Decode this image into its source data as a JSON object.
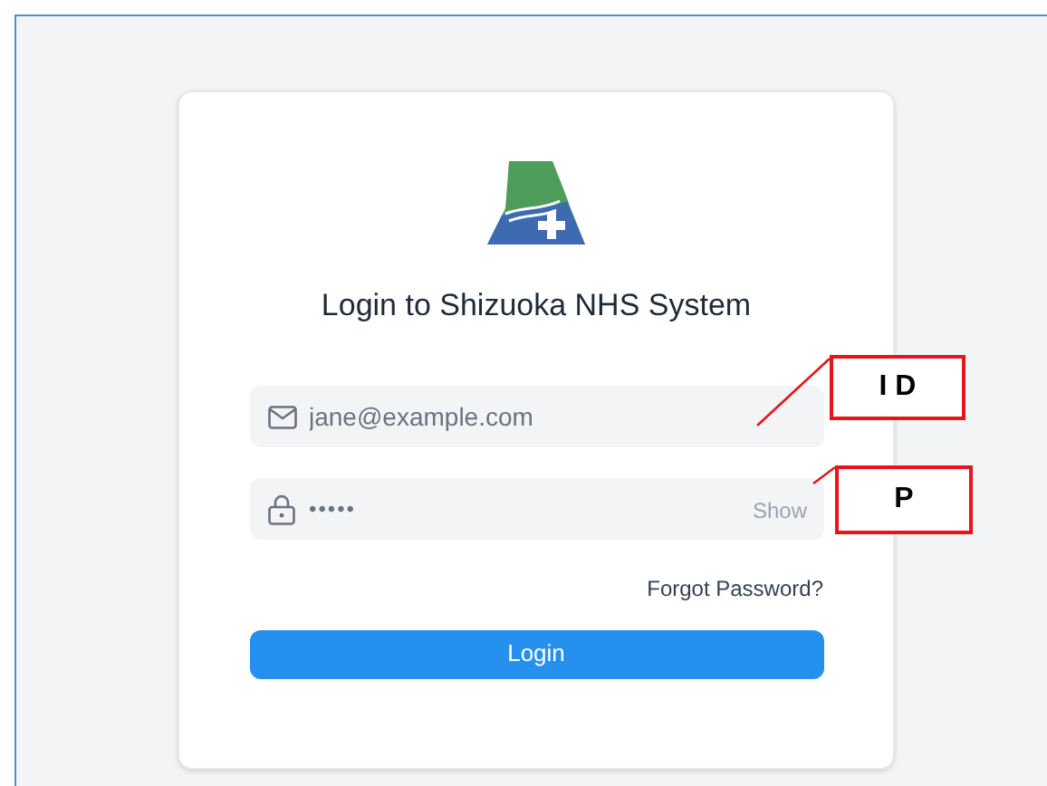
{
  "title": "Login to Shizuoka NHS System",
  "email_field": {
    "placeholder": "jane@example.com"
  },
  "password_field": {
    "value": "•••••",
    "toggle": "Show"
  },
  "forgot_link": "Forgot Password?",
  "login_button": "Login",
  "annotations": [
    {
      "label": "I D"
    },
    {
      "label": "P"
    }
  ]
}
